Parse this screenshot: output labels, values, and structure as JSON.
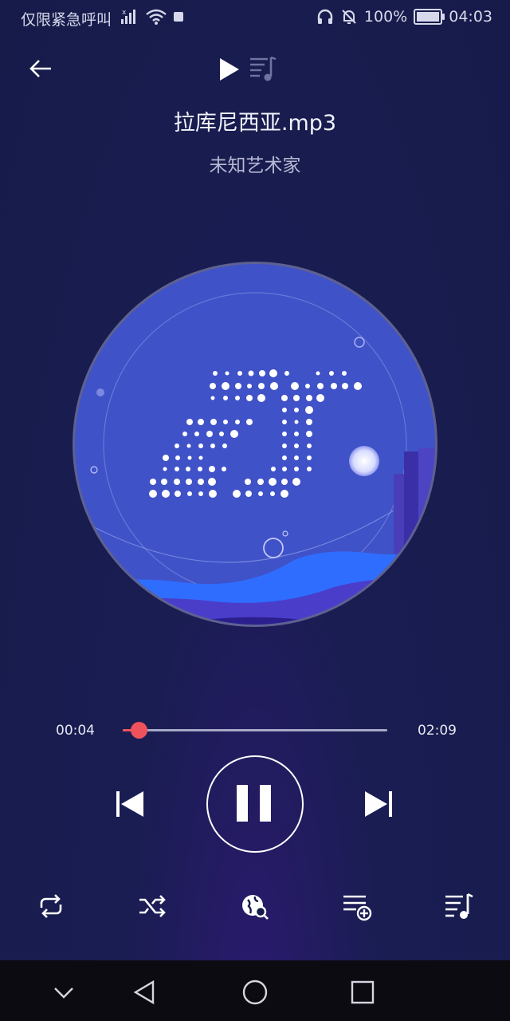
{
  "status_bar": {
    "carrier_text": "仅限紧急呼叫",
    "battery_percent": "100%",
    "time": "04:03"
  },
  "header": {
    "back_icon": "arrow-left-icon",
    "tabs": [
      {
        "name": "now-playing",
        "icon": "play-icon",
        "active": true
      },
      {
        "name": "lyrics-list",
        "icon": "music-list-icon",
        "active": false
      }
    ]
  },
  "track": {
    "title": "拉库尼西亚.mp3",
    "artist": "未知艺术家"
  },
  "progress": {
    "current": "00:04",
    "total": "02:09",
    "fraction": 0.031
  },
  "controls": {
    "previous_icon": "skip-previous-icon",
    "pause_icon": "pause-icon",
    "next_icon": "skip-next-icon"
  },
  "toolbar": {
    "icons": [
      "repeat-icon",
      "shuffle-icon",
      "search-globe-icon",
      "add-to-playlist-icon",
      "playlist-icon"
    ]
  },
  "colors": {
    "accent": "#f0525d",
    "background": "#161b4a",
    "disc_blue": "#3f52c8"
  }
}
